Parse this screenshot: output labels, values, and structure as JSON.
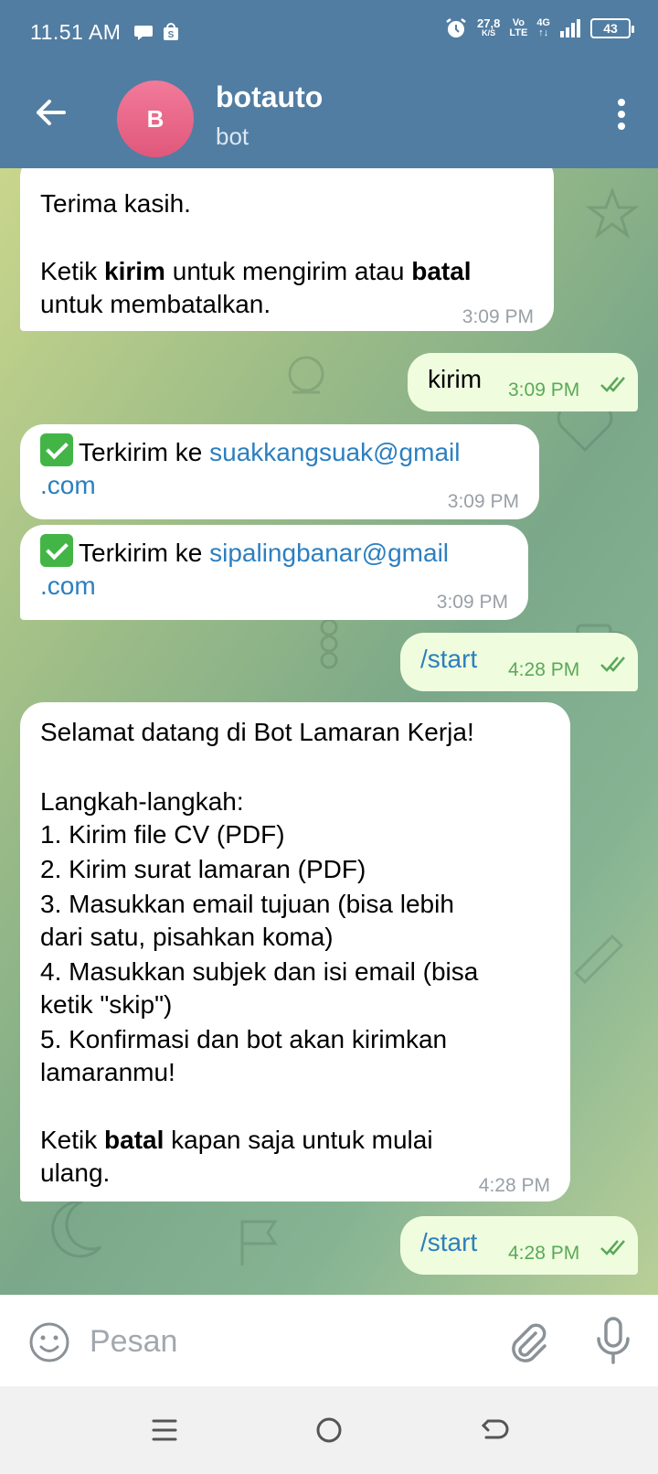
{
  "status_bar": {
    "time": "11.51 AM",
    "speed_value": "27,8",
    "speed_unit": "K/S",
    "volte_top": "Vo",
    "volte_bottom": "LTE",
    "network": "4G",
    "battery": "43"
  },
  "header": {
    "avatar_letter": "B",
    "title": "botauto",
    "subtitle": "bot"
  },
  "messages": [
    {
      "line1": "Terima kasih.",
      "line2a": "Ketik ",
      "bold1": "kirim",
      "line2b": " untuk mengirim atau ",
      "bold2": "batal",
      "line3": "untuk membatalkan.",
      "time": "3:09 PM"
    },
    {
      "text": "kirim",
      "time": "3:09 PM"
    },
    {
      "prefix": "Terkirim ke ",
      "link1": "suakkangsuak@gmail",
      "link2": ".com",
      "time": "3:09 PM"
    },
    {
      "prefix": "Terkirim ke ",
      "link1": "sipalingbanar@gmail",
      "link2": ".com",
      "time": "3:09 PM"
    },
    {
      "text": "/start",
      "time": "4:28 PM"
    },
    {
      "welcome": "Selamat datang di Bot Lamaran Kerja!",
      "steps_title": "Langkah-langkah:",
      "step1": "1. Kirim file CV (PDF)",
      "step2": "2. Kirim surat lamaran (PDF)",
      "step3a": "3. Masukkan email tujuan (bisa lebih",
      "step3b": "dari satu, pisahkan koma)",
      "step4a": "4. Masukkan subjek dan isi email (bisa",
      "step4b": "ketik \"skip\")",
      "step5a": "5. Konfirmasi dan bot akan kirimkan",
      "step5b": "lamaranmu!",
      "footer_a": "Ketik ",
      "footer_bold": "batal",
      "footer_b": " kapan saja untuk mulai",
      "footer_c": "ulang.",
      "time": "4:28 PM"
    },
    {
      "text": "/start",
      "time": "4:28 PM"
    }
  ],
  "input": {
    "placeholder": "Pesan",
    "value": ""
  },
  "icons": {
    "back": "arrow-left-icon",
    "menu": "more-vertical-icon",
    "emoji": "smiley-icon",
    "attach": "paperclip-icon",
    "mic": "microphone-icon",
    "read": "double-check-icon"
  },
  "colors": {
    "header": "#517da2",
    "incoming_bubble": "#ffffff",
    "outgoing_bubble": "#effdde",
    "link": "#2c7fbf",
    "outgoing_time": "#5ba858"
  }
}
